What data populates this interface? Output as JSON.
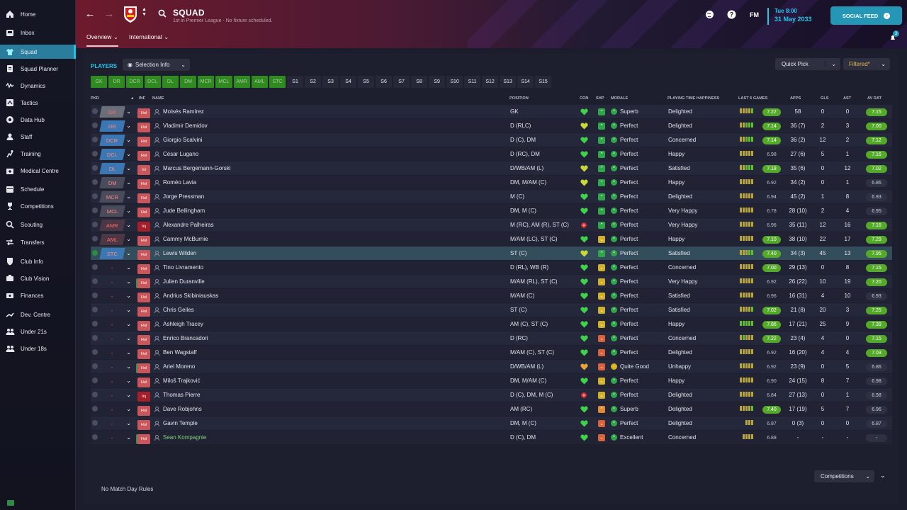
{
  "sidebar": {
    "items": [
      {
        "label": "Home",
        "icon": "home-icon",
        "active": false
      },
      {
        "label": "Inbox",
        "icon": "inbox-icon",
        "active": false
      },
      {
        "label": "Squad",
        "icon": "shirt-icon",
        "active": true
      },
      {
        "label": "Squad Planner",
        "icon": "planner-icon",
        "active": false
      },
      {
        "label": "Dynamics",
        "icon": "dynamics-icon",
        "active": false
      },
      {
        "label": "Tactics",
        "icon": "tactics-icon",
        "active": false
      },
      {
        "label": "Data Hub",
        "icon": "data-hub-icon",
        "active": false
      },
      {
        "label": "Staff",
        "icon": "staff-icon",
        "active": false
      },
      {
        "label": "Training",
        "icon": "training-icon",
        "active": false
      },
      {
        "label": "Medical Centre",
        "icon": "medical-icon",
        "active": false
      },
      {
        "label": "Schedule",
        "icon": "schedule-icon",
        "active": false
      },
      {
        "label": "Competitions",
        "icon": "trophy-icon",
        "active": false
      },
      {
        "label": "Scouting",
        "icon": "scouting-icon",
        "active": false
      },
      {
        "label": "Transfers",
        "icon": "transfers-icon",
        "active": false
      },
      {
        "label": "Club Info",
        "icon": "shield-icon",
        "active": false
      },
      {
        "label": "Club Vision",
        "icon": "vision-icon",
        "active": false
      },
      {
        "label": "Finances",
        "icon": "finances-icon",
        "active": false
      },
      {
        "label": "Dev. Centre",
        "icon": "dev-centre-icon",
        "active": false
      },
      {
        "label": "Under 21s",
        "icon": "team-icon",
        "active": false
      },
      {
        "label": "Under 18s",
        "icon": "team-icon",
        "active": false
      }
    ]
  },
  "header": {
    "title": "SQUAD",
    "subtitle": "1st in Premier League - No fixture scheduled.",
    "tabs": [
      "Overview",
      "International"
    ],
    "fm_label": "FM",
    "date_day": "Tue 8:00",
    "date_full": "31 May 2033",
    "social_feed_label": "SOCIAL FEED",
    "notification_count": "3"
  },
  "main": {
    "players_title": "PLAYERS",
    "selection_info_label": "Selection Info",
    "quick_pick_label": "Quick Pick",
    "filtered_label": "Filtered*",
    "position_filters": [
      "GK",
      "DR",
      "DCR",
      "DCL",
      "DL",
      "DM",
      "MCR",
      "MCL",
      "AMR",
      "AML",
      "STC"
    ],
    "slot_filters": [
      "S1",
      "S2",
      "S3",
      "S4",
      "S5",
      "S6",
      "S7",
      "S8",
      "S9",
      "S10",
      "S11",
      "S12",
      "S13",
      "S14",
      "S15"
    ],
    "columns": {
      "pkd": "PKD",
      "inf": "INF",
      "name": "NAME",
      "position": "POSITION",
      "con": "CON",
      "shp": "SHP",
      "morale": "MORALE",
      "happiness": "PLAYING TIME HAPPINESS",
      "last5": "LAST 5 GAMES",
      "apps": "APPS",
      "gls": "GLS",
      "ast": "AST",
      "avrat": "AV RAT"
    },
    "footer_text": "No Match Day Rules",
    "competitions_label": "Competitions"
  },
  "colors": {
    "accent": "#29c6e8",
    "rating_green": "#54a92a",
    "selection_blue": "#3b77b2"
  },
  "players": [
    {
      "slot": "GK",
      "chip": "gk",
      "inf": "Hol",
      "name": "Moisés Ramírez",
      "position": "GK",
      "con": "heart",
      "shp": "g",
      "morale": "Superb",
      "happiness": "Delighted",
      "form": "yyyyg",
      "last": "7.22",
      "apps": "58",
      "gls": "0",
      "ast": "0",
      "avrat": "7.15",
      "avg": true
    },
    {
      "slot": "DR",
      "chip": "blue",
      "inf": "Hol",
      "name": "Vladimir Demidov",
      "position": "D (RLC)",
      "con": "heart-y",
      "shp": "g",
      "morale": "Perfect",
      "happiness": "Delighted",
      "form": "yyggg",
      "last": "7.14",
      "apps": "36 (7)",
      "gls": "2",
      "ast": "3",
      "avrat": "7.00",
      "avg": true
    },
    {
      "slot": "DCR",
      "chip": "blue",
      "inf": "Hol",
      "name": "Giorgio Scalvini",
      "position": "D (C), DM",
      "con": "heart",
      "shp": "g",
      "morale": "Perfect",
      "happiness": "Concerned",
      "form": "yyggg",
      "last": "7.14",
      "apps": "36 (2)",
      "gls": "12",
      "ast": "2",
      "avrat": "7.12",
      "avg": true
    },
    {
      "slot": "DCL",
      "chip": "blue",
      "inf": "Hol",
      "name": "César Lugano",
      "position": "D (RC), DM",
      "con": "heart",
      "shp": "g",
      "morale": "Perfect",
      "happiness": "Happy",
      "form": "yyyyy",
      "last": "6.98",
      "apps": "27 (6)",
      "gls": "5",
      "ast": "1",
      "avrat": "7.16",
      "avg": true
    },
    {
      "slot": "DL",
      "chip": "blue",
      "inf": "Int",
      "name": "Marcus Bergemann-Gorski",
      "position": "D/WB/AM (L)",
      "con": "heart-y",
      "shp": "g",
      "morale": "Perfect",
      "happiness": "Satisfied",
      "form": "yyggg",
      "last": "7.18",
      "apps": "35 (6)",
      "gls": "0",
      "ast": "12",
      "avrat": "7.02",
      "avg": true
    },
    {
      "slot": "DM",
      "chip": "grey",
      "inf": "Hol",
      "name": "Roméo Lavia",
      "position": "DM, M/AM (C)",
      "con": "heart-y",
      "shp": "g",
      "morale": "Perfect",
      "happiness": "Happy",
      "form": "yyyyy",
      "last": "6.92",
      "apps": "34 (2)",
      "gls": "0",
      "ast": "1",
      "avrat": "6.86",
      "avg": false
    },
    {
      "slot": "MCR",
      "chip": "grey",
      "inf": "Hol",
      "name": "Jorge Pressman",
      "position": "M (C)",
      "con": "heart",
      "shp": "gu",
      "morale": "Perfect",
      "happiness": "Delighted",
      "form": "yyyyy",
      "last": "6.94",
      "apps": "45 (2)",
      "gls": "1",
      "ast": "8",
      "avrat": "6.93",
      "avg": false
    },
    {
      "slot": "MCL",
      "chip": "grey",
      "inf": "Hol",
      "name": "Jude Bellingham",
      "position": "DM, M (C)",
      "con": "heart",
      "shp": "gu",
      "morale": "Perfect",
      "happiness": "Very Happy",
      "form": "yyyyy",
      "last": "6.78",
      "apps": "28 (10)",
      "gls": "2",
      "ast": "4",
      "avrat": "6.95",
      "avg": false
    },
    {
      "slot": "AMR",
      "chip": "red",
      "inf": "Inj",
      "name": "Alexandre Palheiras",
      "position": "M (RC), AM (R), ST (C)",
      "con": "injury",
      "shp": "gu",
      "morale": "Perfect",
      "happiness": "Very Happy",
      "form": "yyyyy",
      "last": "6.96",
      "apps": "35 (11)",
      "gls": "12",
      "ast": "16",
      "avrat": "7.16",
      "avg": true
    },
    {
      "slot": "AML",
      "chip": "red",
      "inf": "Hol",
      "name": "Cammy McBurnie",
      "position": "M/AM (LC), ST (C)",
      "con": "heart",
      "shp": "yd",
      "morale": "Perfect",
      "happiness": "Happy",
      "form": "yyyyy",
      "last": "7.10",
      "apps": "38 (10)",
      "gls": "22",
      "ast": "17",
      "avrat": "7.29",
      "avg": true
    },
    {
      "slot": "STC",
      "chip": "blue",
      "inf": "Hol",
      "name": "Lewis Wilden",
      "position": "ST (C)",
      "con": "heart-y",
      "shp": "gu",
      "morale": "Perfect",
      "happiness": "Satisfied",
      "form": "yyygg",
      "last": "7.40",
      "apps": "34 (3)",
      "gls": "45",
      "ast": "13",
      "avrat": "7.95",
      "avg": true,
      "selected": true
    },
    {
      "slot": "-",
      "chip": "none",
      "inf": "Hol",
      "name": "Tino Livramento",
      "position": "D (RL), WB (R)",
      "con": "heart",
      "shp": "yd",
      "morale": "Perfect",
      "happiness": "Concerned",
      "form": "yyyyy",
      "last": "7.00",
      "apps": "29 (13)",
      "gls": "0",
      "ast": "8",
      "avrat": "7.15",
      "avg": true
    },
    {
      "slot": "-",
      "chip": "none",
      "inf": "Hol",
      "name": "Julien Duranville",
      "position": "M/AM (RL), ST (C)",
      "con": "heart",
      "shp": "yd",
      "morale": "Perfect",
      "happiness": "Very Happy",
      "form": "yyyyy",
      "last": "6.92",
      "apps": "26 (22)",
      "gls": "10",
      "ast": "19",
      "avrat": "7.20",
      "avg": true,
      "hol_r": true
    },
    {
      "slot": "-",
      "chip": "none",
      "inf": "Hol",
      "name": "Andrius Skibiniauskas",
      "position": "M/AM (C)",
      "con": "heart",
      "shp": "yd",
      "morale": "Perfect",
      "happiness": "Satisfied",
      "form": "yyyyy",
      "last": "6.96",
      "apps": "16 (31)",
      "gls": "4",
      "ast": "10",
      "avrat": "6.93",
      "avg": false
    },
    {
      "slot": "-",
      "chip": "none",
      "inf": "Hol",
      "name": "Chris Geiles",
      "position": "ST (C)",
      "con": "heart",
      "shp": "yd",
      "morale": "Perfect",
      "happiness": "Satisfied",
      "form": "yyyyg",
      "last": "7.02",
      "apps": "21 (8)",
      "gls": "20",
      "ast": "3",
      "avrat": "7.25",
      "avg": true
    },
    {
      "slot": "-",
      "chip": "none",
      "inf": "Hol",
      "name": "Ashleigh Tracey",
      "position": "AM (C), ST (C)",
      "con": "heart",
      "shp": "yd",
      "morale": "Perfect",
      "happiness": "Happy",
      "form": "ggggg",
      "last": "7.86",
      "apps": "17 (21)",
      "gls": "25",
      "ast": "9",
      "avrat": "7.39",
      "avg": true
    },
    {
      "slot": "-",
      "chip": "none",
      "inf": "Hol",
      "name": "Enrico Brancadori",
      "position": "D (RC)",
      "con": "heart",
      "shp": "rd",
      "morale": "Perfect",
      "happiness": "Concerned",
      "form": "ygyyy",
      "last": "7.22",
      "apps": "23 (4)",
      "gls": "4",
      "ast": "0",
      "avrat": "7.15",
      "avg": true
    },
    {
      "slot": "-",
      "chip": "none",
      "inf": "Hol",
      "name": "Ben Wagstaff",
      "position": "M/AM (C), ST (C)",
      "con": "heart",
      "shp": "rd",
      "morale": "Perfect",
      "happiness": "Delighted",
      "form": "yyyyy",
      "last": "6.92",
      "apps": "16 (20)",
      "gls": "4",
      "ast": "4",
      "avrat": "7.03",
      "avg": true
    },
    {
      "slot": "-",
      "chip": "none",
      "inf": "Hol",
      "name": "Ariel Moreno",
      "position": "D/WB/AM (L)",
      "con": "heart-o",
      "shp": "rd",
      "morale": "Quite Good",
      "happiness": "Unhappy",
      "form": "yyyyy",
      "last": "6.92",
      "apps": "23 (9)",
      "gls": "0",
      "ast": "5",
      "avrat": "6.86",
      "avg": false,
      "hol_r": true,
      "mood": "y"
    },
    {
      "slot": "-",
      "chip": "none",
      "inf": "Hol",
      "name": "Miloš Trajković",
      "position": "DM, M/AM (C)",
      "con": "heart",
      "shp": "yd",
      "morale": "Perfect",
      "happiness": "Happy",
      "form": "yyyyy",
      "last": "6.90",
      "apps": "24 (15)",
      "gls": "8",
      "ast": "7",
      "avrat": "6.98",
      "avg": false
    },
    {
      "slot": "-",
      "chip": "none",
      "inf": "Inj",
      "name": "Thomas Pierre",
      "position": "D (C), DM, M (C)",
      "con": "injury",
      "shp": "yd",
      "morale": "Perfect",
      "happiness": "Delighted",
      "form": "yyyyy",
      "last": "6.84",
      "apps": "27 (13)",
      "gls": "0",
      "ast": "1",
      "avrat": "6.98",
      "avg": false
    },
    {
      "slot": "-",
      "chip": "none",
      "inf": "Hol",
      "name": "Dave Robjohns",
      "position": "AM (RC)",
      "con": "heart",
      "shp": "ou",
      "morale": "Superb",
      "happiness": "Delighted",
      "form": "yyyyg",
      "last": "7.40",
      "apps": "17 (19)",
      "gls": "5",
      "ast": "7",
      "avrat": "6.96",
      "avg": false
    },
    {
      "slot": "-",
      "chip": "none",
      "inf": "Hol",
      "name": "Gavin Temple",
      "position": "DM, M (C)",
      "con": "heart",
      "shp": "rd",
      "morale": "Perfect",
      "happiness": "Delighted",
      "form": "yyy",
      "last": "6.87",
      "apps": "0 (3)",
      "gls": "0",
      "ast": "0",
      "avrat": "6.87",
      "avg": false
    },
    {
      "slot": "-",
      "chip": "none",
      "inf": "Hol",
      "name": "Sean Kompagnie",
      "position": "D (C), DM",
      "con": "heart",
      "shp": "rd",
      "morale": "Excellent",
      "happiness": "Concerned",
      "form": "yyyy",
      "last": "6.88",
      "apps": "-",
      "gls": "-",
      "ast": "-",
      "avrat": "-",
      "avg": false,
      "green_name": true,
      "hol_r": true
    }
  ]
}
